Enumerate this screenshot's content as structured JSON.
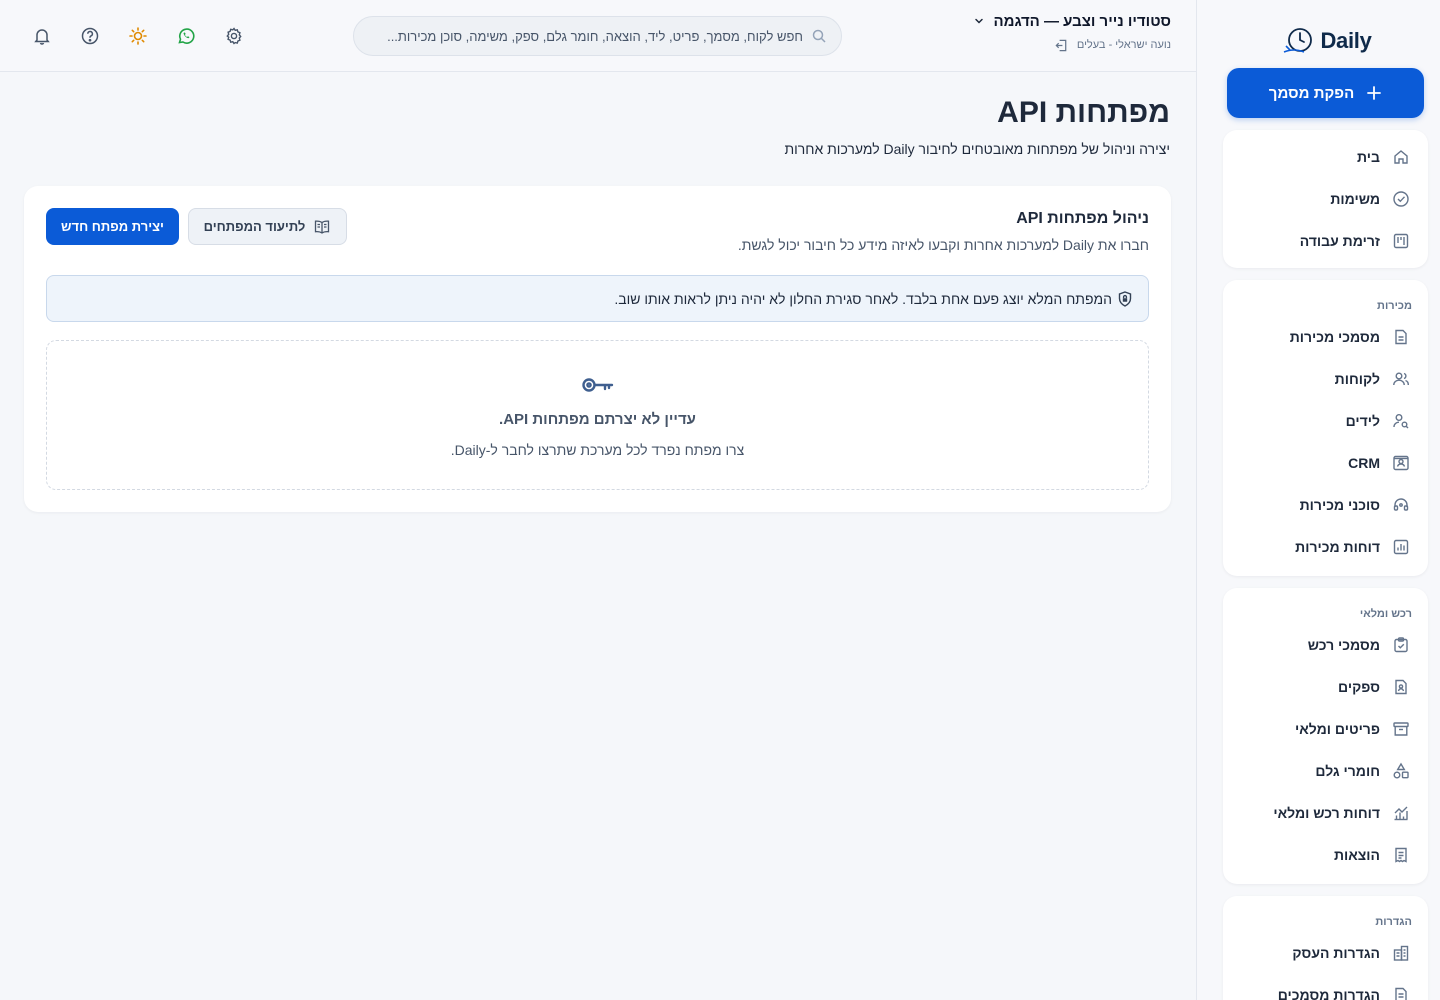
{
  "app": {
    "logo_text": "Daily",
    "primary_action": "הפקת מסמך"
  },
  "header": {
    "org_name": "סטודיו נייר וצבע — הדגמה",
    "user_line": "נועה ישראלי - בעלים",
    "search_placeholder": "חפש לקוח, מסמך, פריט, ליד, הוצאה, חומר גלם, ספק, משימה, סוכן מכירות..."
  },
  "sidebar": {
    "main": [
      {
        "label": "בית",
        "icon": "home-icon"
      },
      {
        "label": "משימות",
        "icon": "check-circle-icon"
      },
      {
        "label": "זרימת עבודה",
        "icon": "kanban-icon"
      }
    ],
    "sales": {
      "title": "מכירות",
      "items": [
        {
          "label": "מסמכי מכירות",
          "icon": "document-icon"
        },
        {
          "label": "לקוחות",
          "icon": "users-icon"
        },
        {
          "label": "לידים",
          "icon": "user-search-icon"
        },
        {
          "label": "CRM",
          "icon": "contact-card-icon"
        },
        {
          "label": "סוכני מכירות",
          "icon": "headset-icon"
        },
        {
          "label": "דוחות מכירות",
          "icon": "bar-chart-icon"
        }
      ]
    },
    "purchasing": {
      "title": "רכש ומלאי",
      "items": [
        {
          "label": "מסמכי רכש",
          "icon": "clipboard-check-icon"
        },
        {
          "label": "ספקים",
          "icon": "supplier-icon"
        },
        {
          "label": "פריטים ומלאי",
          "icon": "archive-icon"
        },
        {
          "label": "חומרי גלם",
          "icon": "shapes-icon"
        },
        {
          "label": "דוחות רכש ומלאי",
          "icon": "line-chart-icon"
        },
        {
          "label": "הוצאות",
          "icon": "receipt-icon"
        }
      ]
    },
    "settings": {
      "title": "הגדרות",
      "items": [
        {
          "label": "הגדרות העסק",
          "icon": "building-icon"
        },
        {
          "label": "הגדרות מסמכים",
          "icon": "document-settings-icon"
        }
      ]
    }
  },
  "page": {
    "title": "מפתחות API",
    "subtitle": "יצירה וניהול של מפתחות מאובטחים לחיבור Daily למערכות אחרות"
  },
  "card": {
    "title": "ניהול מפתחות API",
    "subtitle": "חברו את Daily למערכות אחרות וקבעו לאיזה מידע כל חיבור יכול לגשת.",
    "create_button": "יצירת מפתח חדש",
    "docs_button": "לתיעוד המפתחים",
    "notice": "המפתח המלא יוצג פעם אחת בלבד. לאחר סגירת החלון לא יהיה ניתן לראות אותו שוב.",
    "empty_title": "עדיין לא יצרתם מפתחות API.",
    "empty_subtitle": "צרו מפתח נפרד לכל מערכת שתרצו לחבר ל-Daily."
  },
  "colors": {
    "primary": "#0b5bd7",
    "whatsapp": "#22a447",
    "sun": "#e08a00"
  }
}
